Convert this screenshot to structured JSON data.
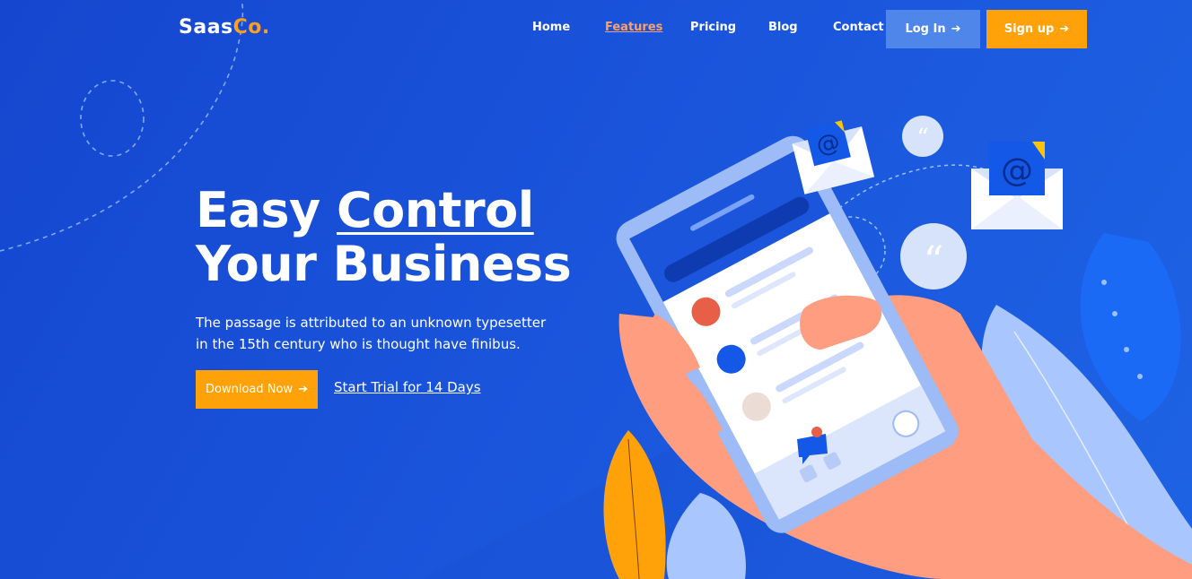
{
  "brand": {
    "name_main": "Saas",
    "name_accent": "Co."
  },
  "nav": {
    "items": [
      {
        "label": "Home"
      },
      {
        "label": "Features"
      },
      {
        "label": "Pricing"
      },
      {
        "label": "Blog"
      },
      {
        "label": "Contact"
      }
    ],
    "active_index": 1,
    "login_label": "Log In",
    "signup_label": "Sign up",
    "arrow": "➔"
  },
  "hero": {
    "title_part1": "Easy",
    "title_underlined": "Control",
    "title_line2": "Your Business",
    "description_line1": "The passage is attributed to an unknown typesetter",
    "description_line2": "in the 15th century who is thought have finibus.",
    "download_label": "Download Now",
    "trial_label": "Start Trial for 14 Days"
  },
  "colors": {
    "background": "#1a55dc",
    "accent_orange": "#ffa20a",
    "login_button": "#4e86ea",
    "active_link": "#ff9f64"
  },
  "icons": {
    "arrow": "arrow-right-icon",
    "email": "email-envelope-icon",
    "quote": "quote-bubble-icon"
  }
}
